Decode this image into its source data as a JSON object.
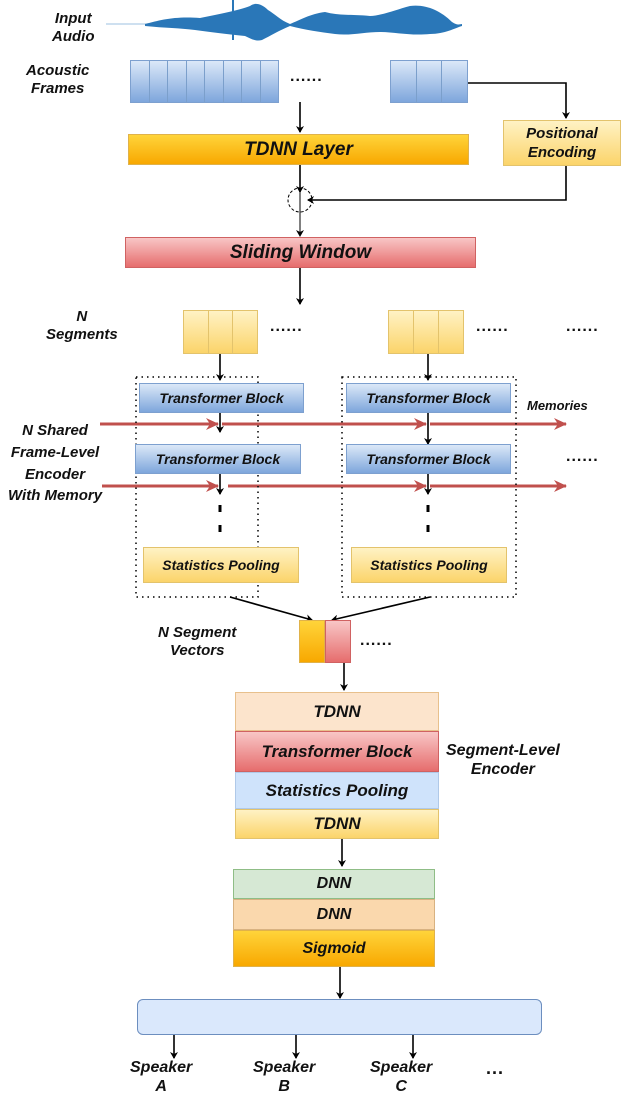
{
  "diagram": {
    "input_audio_label": "Input\nAudio",
    "acoustic_frames_label": "Acoustic\nFrames",
    "frames_ellipsis": "......",
    "tdnn_layer": "TDNN Layer",
    "positional_encoding": "Positional\nEncoding",
    "sliding_window": "Sliding Window",
    "n_segments_label": "N\nSegments",
    "segments_ellipsis_1": "......",
    "segments_ellipsis_2": "......",
    "segments_ellipsis_3": "......",
    "frame_encoder_label": "N Shared\nFrame-Level\nEncoder\nWith Memory",
    "memories_label": "Memories",
    "encoder_ellipsis": "......",
    "encoder_columns": [
      {
        "transformer_block_1": "Transformer Block",
        "transformer_block_2": "Transformer Block",
        "statistics_pooling": "Statistics Pooling"
      },
      {
        "transformer_block_1": "Transformer Block",
        "transformer_block_2": "Transformer Block",
        "statistics_pooling": "Statistics Pooling"
      }
    ],
    "segment_vectors_label": "N Segment\nVectors",
    "segment_vectors_ellipsis": "......",
    "segment_level_encoder": {
      "label": "Segment-Level\nEncoder",
      "layers": [
        "TDNN",
        "Transformer Block",
        "Statistics Pooling",
        "TDNN"
      ]
    },
    "output_layers": [
      "DNN",
      "DNN",
      "Sigmoid"
    ],
    "speakers": [
      "Speaker\nA",
      "Speaker\nB",
      "Speaker\nC"
    ],
    "speakers_ellipsis": "...",
    "colors": {
      "audio_wave": "#2a77b8",
      "memory_arrow": "#c0504d",
      "arrow": "#000000"
    }
  }
}
